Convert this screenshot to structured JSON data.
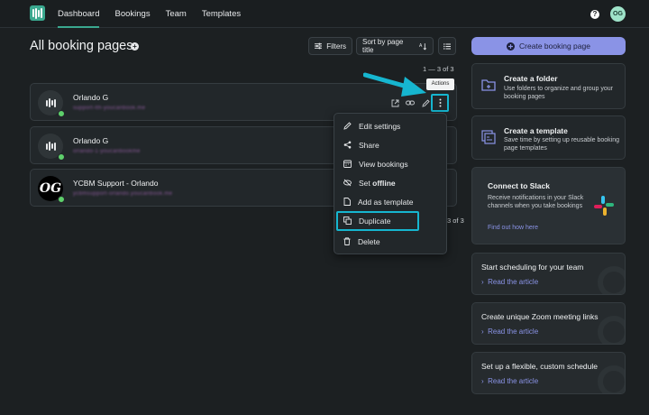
{
  "nav": {
    "items": [
      "Dashboard",
      "Bookings",
      "Team",
      "Templates"
    ],
    "active": "Dashboard",
    "help_label": "?",
    "avatar": "OG"
  },
  "header": {
    "title": "All booking pages",
    "filters_label": "Filters",
    "sort_label": "Sort by page title"
  },
  "pagination": {
    "top": "1 — 3 of 3",
    "bottom": "3 of 3"
  },
  "cards": [
    {
      "name": "Orlando G",
      "sub": "support-lth-youcanbook.me",
      "avatar": "logo"
    },
    {
      "name": "Orlando G",
      "sub": "orlando-1-youcanbookme",
      "avatar": "logo"
    },
    {
      "name": "YCBM Support - Orlando",
      "sub": "ycbmsupport-orlando.youcanbook.me",
      "avatar": "OG"
    }
  ],
  "tooltip": "Actions",
  "menu": {
    "edit": "Edit settings",
    "share": "Share",
    "view": "View bookings",
    "set_prefix": "Set",
    "set_bold": "offline",
    "template": "Add as template",
    "duplicate": "Duplicate",
    "delete": "Delete"
  },
  "sidebar": {
    "create_label": "Create booking page",
    "folder": {
      "title": "Create a folder",
      "desc": "Use folders to organize and group your booking pages"
    },
    "template": {
      "title": "Create a template",
      "desc": "Save time by setting up reusable booking page templates"
    },
    "slack": {
      "title": "Connect to Slack",
      "desc": "Receive notifications in your Slack channels when you take bookings",
      "link": "Find out how here"
    },
    "articles": [
      {
        "title": "Start scheduling for your team",
        "link": "Read the article"
      },
      {
        "title": "Create unique Zoom meeting links",
        "link": "Read the article"
      },
      {
        "title": "Set up a flexible, custom schedule",
        "link": "Read the article"
      }
    ]
  },
  "colors": {
    "accent": "#3aa88f",
    "highlight": "#16b6d0",
    "primary": "#8a93e6",
    "online": "#5ed06b"
  }
}
